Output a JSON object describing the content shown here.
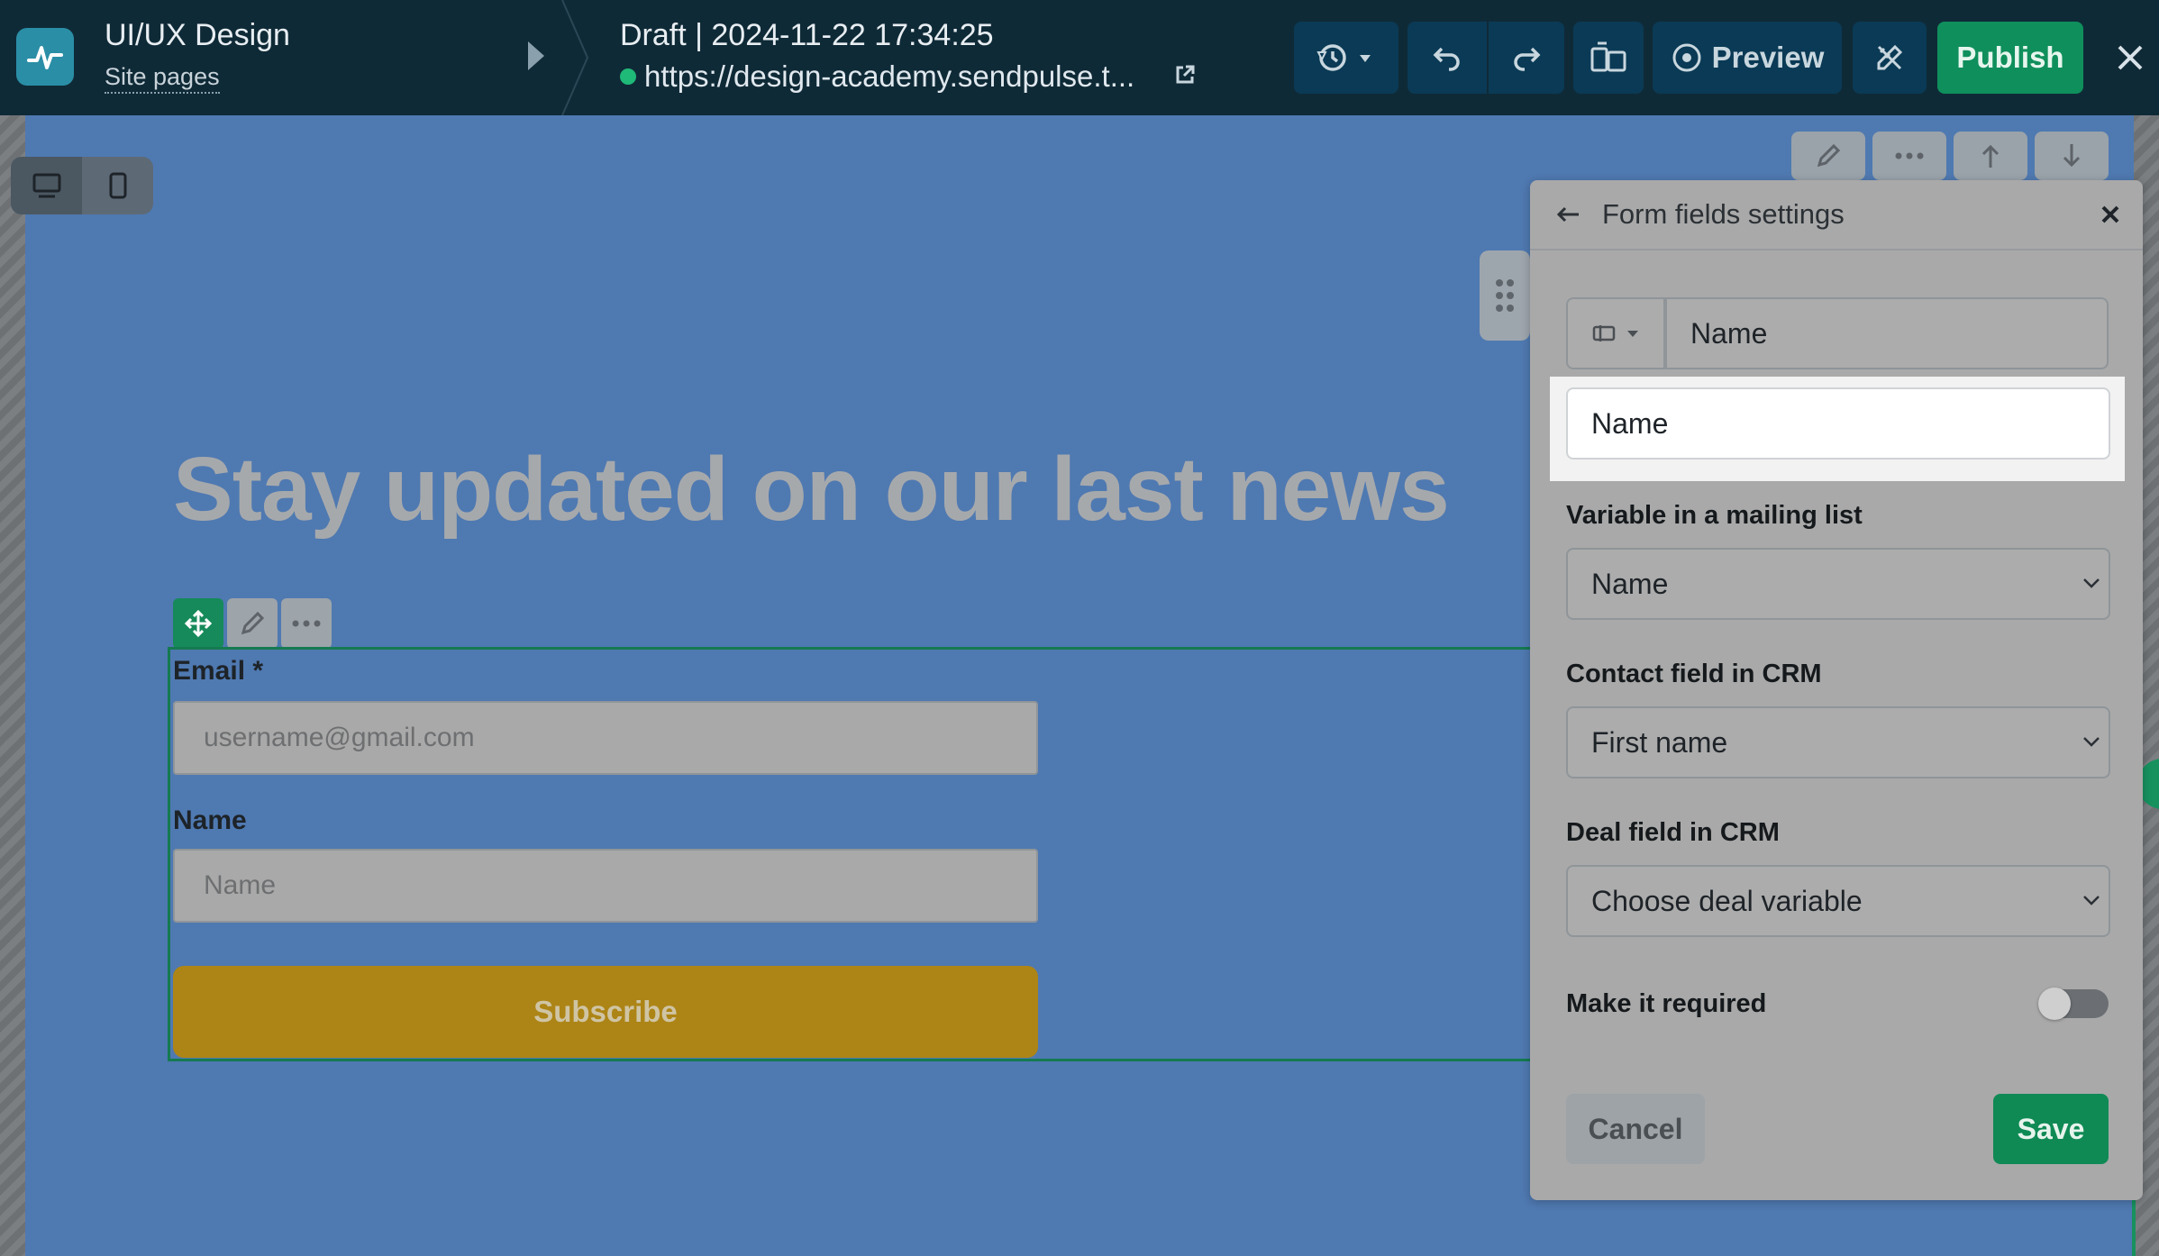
{
  "topbar": {
    "project_title": "UI/UX Design",
    "project_sub": "Site pages",
    "draft_label": "Draft | 2024-11-22 17:34:25",
    "url": "https://design-academy.sendpulse.t...",
    "preview_label": "Preview",
    "publish_label": "Publish"
  },
  "icons": {
    "logo": "pulse-logo-icon",
    "history": "history-icon",
    "undo": "undo-icon",
    "redo": "redo-icon",
    "close": "close-icon",
    "desktop": "desktop-icon",
    "mobile": "mobile-icon"
  },
  "page": {
    "headline": "Stay updated on our last news",
    "form": {
      "email_label": "Email *",
      "email_placeholder": "username@gmail.com",
      "name_label": "Name",
      "name_placeholder": "Name",
      "subscribe_label": "Subscribe"
    }
  },
  "panel": {
    "title": "Form fields settings",
    "field_name": "Name",
    "placeholder_value": "Name",
    "variable_label": "Variable in a mailing list",
    "variable_value": "Name",
    "crm_contact_label": "Contact field in CRM",
    "crm_contact_value": "First name",
    "crm_deal_label": "Deal field in CRM",
    "crm_deal_value": "Choose deal variable",
    "required_label": "Make it required",
    "required_on": false,
    "cancel_label": "Cancel",
    "save_label": "Save"
  },
  "colors": {
    "topbar": "#0f2a37",
    "publish": "#0f8f5c",
    "page_bg": "#4f79b1",
    "subscribe": "#ad8516"
  }
}
